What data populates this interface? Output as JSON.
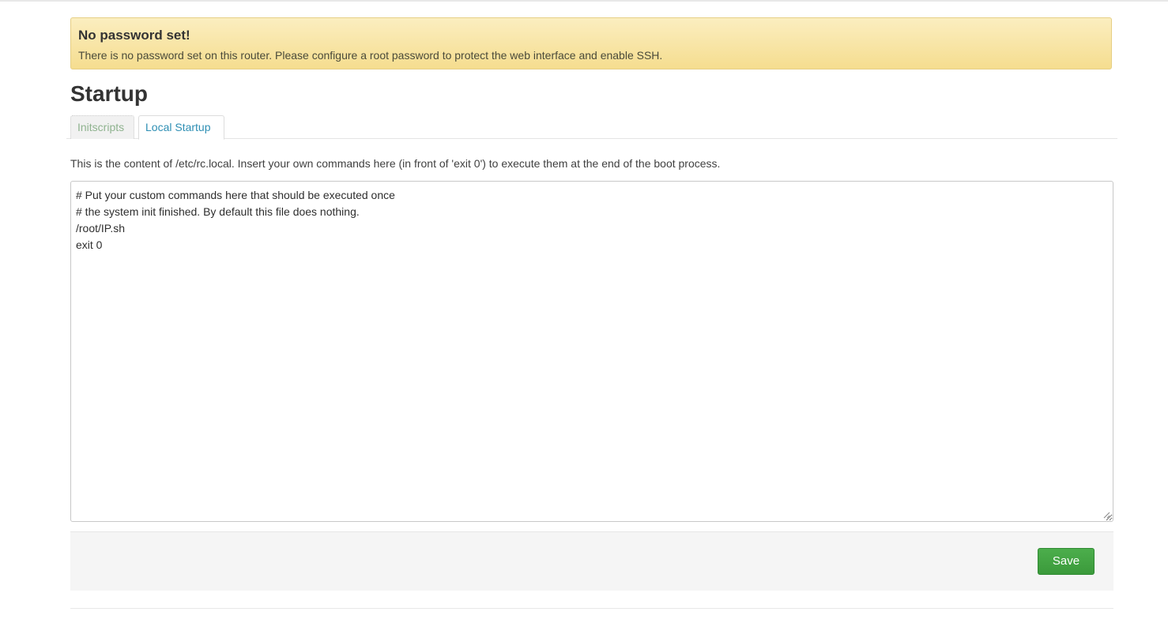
{
  "alert": {
    "title": "No password set!",
    "text": "There is no password set on this router. Please configure a root password to protect the web interface and enable SSH."
  },
  "page": {
    "title": "Startup"
  },
  "tabs": [
    {
      "label": "Initscripts",
      "active": false
    },
    {
      "label": "Local Startup",
      "active": true
    }
  ],
  "local_startup": {
    "description": "This is the content of /etc/rc.local. Insert your own commands here (in front of 'exit 0') to execute them at the end of the boot process.",
    "content_lines": [
      "# Put your custom commands here that should be executed once",
      "# the system init finished. By default this file does nothing.",
      "/root/IP.sh",
      "exit 0"
    ]
  },
  "footer": {
    "save_label": "Save"
  },
  "colors": {
    "alert_bg": "#f5dd8f",
    "tab_active_text": "#2e8fb4",
    "tab_inactive_text": "#8fb38f",
    "save_button": "#3b9a3b"
  }
}
